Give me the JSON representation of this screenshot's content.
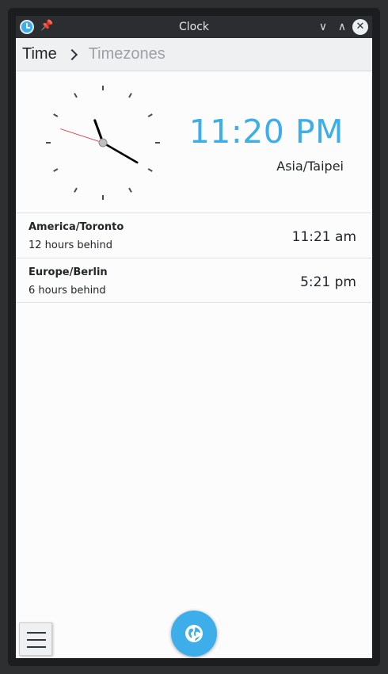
{
  "window": {
    "title": "Clock",
    "pin_icon": "📌",
    "minimize_glyph": "∨",
    "maximize_glyph": "∧",
    "close_glyph": "✕"
  },
  "breadcrumb": {
    "current": "Time",
    "next": "Timezones"
  },
  "clock": {
    "time": "11:20 PM",
    "zone": "Asia/Taipei",
    "hour": 23,
    "minute": 20,
    "second": 48,
    "second_hand_color": "#da4453"
  },
  "timezones": [
    {
      "name": "America/Toronto",
      "diff": "12 hours behind",
      "time": "11:21 am"
    },
    {
      "name": "Europe/Berlin",
      "diff": "6 hours behind",
      "time": "5:21 pm"
    }
  ],
  "colors": {
    "accent": "#3daee9",
    "text": "#232629"
  },
  "icons": {
    "app": "clock-icon",
    "menu": "hamburger-menu-icon",
    "fab": "globe-icon"
  }
}
